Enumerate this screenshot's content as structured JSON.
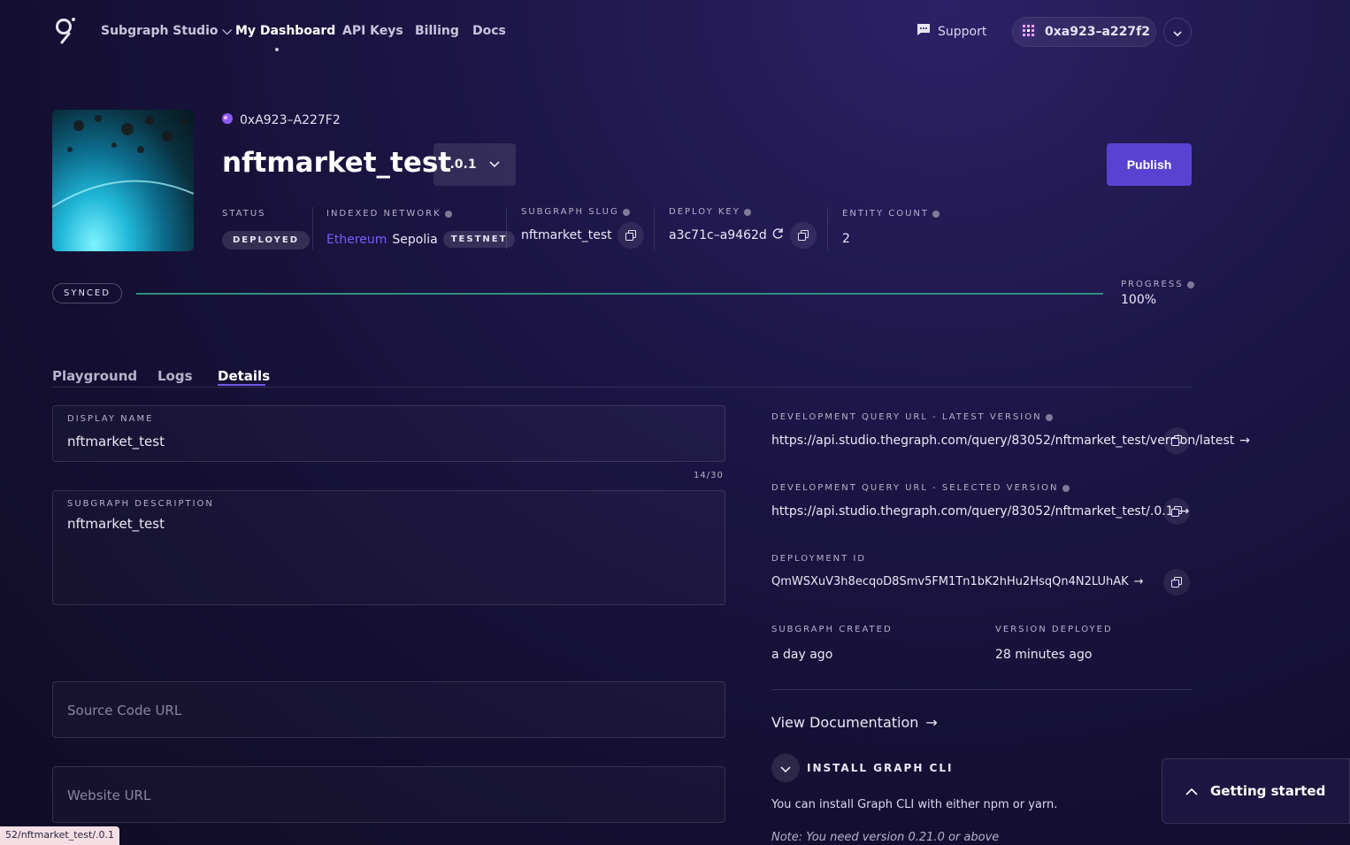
{
  "nav": {
    "studio": "Subgraph Studio",
    "dashboard": "My Dashboard",
    "api_keys": "API Keys",
    "billing": "Billing",
    "docs": "Docs",
    "support": "Support",
    "account": "0xa923–a227f2"
  },
  "subgraph": {
    "owner": "0xA923–A227F2",
    "title": "nftmarket_test",
    "version": ".0.1",
    "publish": "Publish"
  },
  "meta": {
    "status_label": "STATUS",
    "status_value": "DEPLOYED",
    "network_label": "INDEXED NETWORK",
    "network_chain": "Ethereum",
    "network_name": "Sepolia",
    "network_badge": "TESTNET",
    "slug_label": "SUBGRAPH SLUG",
    "slug_value": "nftmarket_test",
    "deploy_key_label": "DEPLOY KEY",
    "deploy_key_value": "a3c71c–a9462d",
    "entity_label": "ENTITY COUNT",
    "entity_value": "2"
  },
  "sync": {
    "badge": "SYNCED",
    "progress_label": "PROGRESS",
    "progress_value": "100%",
    "progress_fraction": 1.0
  },
  "tabs": [
    "Playground",
    "Logs",
    "Details"
  ],
  "form": {
    "display_name_label": "DISPLAY NAME",
    "display_name_value": "nftmarket_test",
    "counter": "14/30",
    "description_label": "SUBGRAPH DESCRIPTION",
    "description_value": "nftmarket_test",
    "source_placeholder": "Source Code URL",
    "website_placeholder": "Website URL"
  },
  "details": {
    "latest_label": "DEVELOPMENT QUERY URL - LATEST VERSION",
    "latest_url": "https://api.studio.thegraph.com/query/83052/nftmarket_test/version/latest",
    "selected_label": "DEVELOPMENT QUERY URL - SELECTED VERSION",
    "selected_url": "https://api.studio.thegraph.com/query/83052/nftmarket_test/.0.1",
    "deployment_label": "DEPLOYMENT ID",
    "deployment_id": "QmWSXuV3h8ecqoD8Smv5FM1Tn1bK2hHu2HsqQn4N2LUhAK",
    "created_label": "SUBGRAPH CREATED",
    "created_value": "a day ago",
    "deployed_label": "VERSION DEPLOYED",
    "deployed_value": "28 minutes ago",
    "view_doc": "View Documentation",
    "install_label": "INSTALL GRAPH CLI",
    "install_text": "You can install Graph CLI with either npm or yarn.",
    "install_note": "Note: You need version 0.21.0 or above"
  },
  "getting_started": "Getting started",
  "statusbar": "52/nftmarket_test/.0.1",
  "colors": {
    "accent": "#5942d1",
    "network_link": "#7b5cf5",
    "progress": "#2f8f7e"
  }
}
